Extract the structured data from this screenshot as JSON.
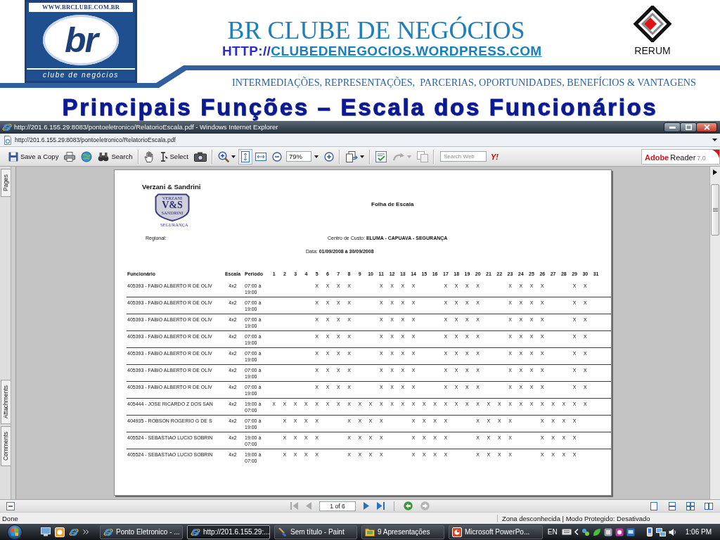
{
  "header": {
    "logo": {
      "web_address": "WWW.BRCLUBE.COM.BR",
      "letters": "br",
      "caption": "clube de negócios"
    },
    "title": "BR CLUBE DE NEGÓCIOS",
    "url_prefix": "HTTP://",
    "url_link": "CLUBEDENEGOCIOS.WORDPRESS.COM",
    "partner_logo": "RERUM",
    "tagline": "INTERMEDIAÇÕES, REPRESENTAÇÕES,  PARCERIAS, OPORTUNIDADES, BENEFÍCIOS & VANTAGENS"
  },
  "slide_title": "Principais Funções – Escala dos Funcionários",
  "window": {
    "title": "http://201.6.155.29:8083/pontoeletronico/RelatorioEscala.pdf - Windows Internet Explorer"
  },
  "address_bar": {
    "value": "http://201.6.155.29:8083/pontoeletronico/RelatorioEscala.pdf"
  },
  "toolbar": {
    "save_label": "Save a Copy",
    "search_label": "Search",
    "select_label": "Select",
    "zoom_value": "79%",
    "arrow_tool_disabled": true,
    "copy_disabled": true,
    "web_search_placeholder": "Search Web",
    "provider_label": "Y!",
    "badge": {
      "brand": "Adobe",
      "product": "Reader",
      "version": "7.0"
    }
  },
  "side_tabs": [
    "Pages",
    "Attachments",
    "Comments"
  ],
  "document": {
    "company": "Verzani & Sandrini",
    "logo": {
      "top": "VERZANI",
      "mark": "V&S",
      "bottom": "SANDRINI",
      "caption": "SEGURANÇA"
    },
    "report_title": "Folha de Escala",
    "regional_label": "Regional:",
    "cost_center": "Centro de Custo: **ELUMA - CAPUAVA - SEGURANÇA**",
    "period": "Data: **01/09/2008 à 30/09/2008**",
    "table": {
      "columns": [
        "Funcionário",
        "Escala",
        "Periodo",
        "1",
        "2",
        "3",
        "4",
        "5",
        "6",
        "7",
        "8",
        "9",
        "10",
        "11",
        "12",
        "13",
        "14",
        "15",
        "16",
        "17",
        "18",
        "19",
        "20",
        "21",
        "22",
        "23",
        "24",
        "25",
        "26",
        "27",
        "28",
        "29",
        "30",
        "31"
      ],
      "rows": [
        {
          "employee": "405393 - FABIO ALBERTO R DE OLIV",
          "scale": "4x2",
          "period": "07:00 à 19:00",
          "days": [
            {
              "kind": "empty"
            },
            {
              "kind": "empty"
            },
            {
              "kind": "empty"
            },
            {
              "kind": "empty"
            },
            {
              "kind": "text",
              "text": "X"
            },
            {
              "kind": "text",
              "text": "X"
            },
            {
              "kind": "text",
              "text": "X"
            },
            {
              "kind": "text",
              "text": "X"
            },
            {
              "kind": "empty"
            },
            {
              "kind": "empty"
            },
            {
              "kind": "text",
              "text": "X"
            },
            {
              "kind": "text",
              "text": "X"
            },
            {
              "kind": "text",
              "text": "X"
            },
            {
              "kind": "text",
              "text": "X"
            },
            {
              "kind": "empty"
            },
            {
              "kind": "empty"
            },
            {
              "kind": "text",
              "text": "X"
            },
            {
              "kind": "text",
              "text": "X"
            },
            {
              "kind": "text",
              "text": "X"
            },
            {
              "kind": "text",
              "text": "X"
            },
            {
              "kind": "empty"
            },
            {
              "kind": "empty"
            },
            {
              "kind": "text",
              "text": "X"
            },
            {
              "kind": "text",
              "text": "X"
            },
            {
              "kind": "text",
              "text": "X"
            },
            {
              "kind": "text",
              "text": "X"
            },
            {
              "kind": "empty"
            },
            {
              "kind": "empty"
            },
            {
              "kind": "text",
              "text": "X"
            },
            {
              "kind": "text",
              "text": "X"
            },
            {
              "kind": "empty"
            }
          ]
        },
        {
          "employee": "405393 - FABIO ALBERTO R DE OLIV",
          "scale": "4x2",
          "period": "07:00 à 19:00",
          "days": [
            {
              "kind": "empty"
            },
            {
              "kind": "empty"
            },
            {
              "kind": "empty"
            },
            {
              "kind": "empty"
            },
            {
              "kind": "text",
              "text": "X"
            },
            {
              "kind": "text",
              "text": "X"
            },
            {
              "kind": "text",
              "text": "X"
            },
            {
              "kind": "text",
              "text": "X"
            },
            {
              "kind": "empty"
            },
            {
              "kind": "empty"
            },
            {
              "kind": "text",
              "text": "X"
            },
            {
              "kind": "text",
              "text": "X"
            },
            {
              "kind": "text",
              "text": "X"
            },
            {
              "kind": "text",
              "text": "X"
            },
            {
              "kind": "empty"
            },
            {
              "kind": "empty"
            },
            {
              "kind": "text",
              "text": "X"
            },
            {
              "kind": "text",
              "text": "X"
            },
            {
              "kind": "text",
              "text": "X"
            },
            {
              "kind": "text",
              "text": "X"
            },
            {
              "kind": "empty"
            },
            {
              "kind": "empty"
            },
            {
              "kind": "text",
              "text": "X"
            },
            {
              "kind": "text",
              "text": "X"
            },
            {
              "kind": "text",
              "text": "X"
            },
            {
              "kind": "text",
              "text": "X"
            },
            {
              "kind": "empty"
            },
            {
              "kind": "empty"
            },
            {
              "kind": "text",
              "text": "X"
            },
            {
              "kind": "text",
              "text": "X"
            },
            {
              "kind": "empty"
            }
          ]
        },
        {
          "employee": "405393 - FABIO ALBERTO R DE OLIV",
          "scale": "4x2",
          "period": "07:00 à 19:00",
          "days": [
            {
              "kind": "empty"
            },
            {
              "kind": "empty"
            },
            {
              "kind": "empty"
            },
            {
              "kind": "empty"
            },
            {
              "kind": "text",
              "text": "X"
            },
            {
              "kind": "text",
              "text": "X"
            },
            {
              "kind": "text",
              "text": "X"
            },
            {
              "kind": "text",
              "text": "X"
            },
            {
              "kind": "empty"
            },
            {
              "kind": "empty"
            },
            {
              "kind": "text",
              "text": "X"
            },
            {
              "kind": "text",
              "text": "X"
            },
            {
              "kind": "text",
              "text": "X"
            },
            {
              "kind": "text",
              "text": "X"
            },
            {
              "kind": "empty"
            },
            {
              "kind": "empty"
            },
            {
              "kind": "text",
              "text": "X"
            },
            {
              "kind": "text",
              "text": "X"
            },
            {
              "kind": "text",
              "text": "X"
            },
            {
              "kind": "text",
              "text": "X"
            },
            {
              "kind": "empty"
            },
            {
              "kind": "empty"
            },
            {
              "kind": "text",
              "text": "X"
            },
            {
              "kind": "text",
              "text": "X"
            },
            {
              "kind": "text",
              "text": "X"
            },
            {
              "kind": "text",
              "text": "X"
            },
            {
              "kind": "empty"
            },
            {
              "kind": "empty"
            },
            {
              "kind": "text",
              "text": "X"
            },
            {
              "kind": "text",
              "text": "X"
            },
            {
              "kind": "empty"
            }
          ]
        },
        {
          "employee": "405393 - FABIO ALBERTO R DE OLIV",
          "scale": "4x2",
          "period": "07:00 à 19:00",
          "days": [
            {
              "kind": "empty"
            },
            {
              "kind": "empty"
            },
            {
              "kind": "empty"
            },
            {
              "kind": "empty"
            },
            {
              "kind": "text",
              "text": "X"
            },
            {
              "kind": "text",
              "text": "X"
            },
            {
              "kind": "text",
              "text": "X"
            },
            {
              "kind": "text",
              "text": "X"
            },
            {
              "kind": "empty"
            },
            {
              "kind": "empty"
            },
            {
              "kind": "text",
              "text": "X"
            },
            {
              "kind": "text",
              "text": "X"
            },
            {
              "kind": "text",
              "text": "X"
            },
            {
              "kind": "text",
              "text": "X"
            },
            {
              "kind": "empty"
            },
            {
              "kind": "empty"
            },
            {
              "kind": "text",
              "text": "X"
            },
            {
              "kind": "text",
              "text": "X"
            },
            {
              "kind": "text",
              "text": "X"
            },
            {
              "kind": "text",
              "text": "X"
            },
            {
              "kind": "empty"
            },
            {
              "kind": "empty"
            },
            {
              "kind": "text",
              "text": "X"
            },
            {
              "kind": "text",
              "text": "X"
            },
            {
              "kind": "text",
              "text": "X"
            },
            {
              "kind": "text",
              "text": "X"
            },
            {
              "kind": "empty"
            },
            {
              "kind": "empty"
            },
            {
              "kind": "text",
              "text": "X"
            },
            {
              "kind": "text",
              "text": "X"
            },
            {
              "kind": "empty"
            }
          ]
        },
        {
          "employee": "405393 - FABIO ALBERTO R DE OLIV",
          "scale": "4x2",
          "period": "07:00 à 19:00",
          "days": [
            {
              "kind": "empty"
            },
            {
              "kind": "empty"
            },
            {
              "kind": "empty"
            },
            {
              "kind": "empty"
            },
            {
              "kind": "text",
              "text": "X"
            },
            {
              "kind": "text",
              "text": "X"
            },
            {
              "kind": "text",
              "text": "X"
            },
            {
              "kind": "text",
              "text": "X"
            },
            {
              "kind": "empty"
            },
            {
              "kind": "empty"
            },
            {
              "kind": "text",
              "text": "X"
            },
            {
              "kind": "text",
              "text": "X"
            },
            {
              "kind": "text",
              "text": "X"
            },
            {
              "kind": "text",
              "text": "X"
            },
            {
              "kind": "empty"
            },
            {
              "kind": "empty"
            },
            {
              "kind": "text",
              "text": "X"
            },
            {
              "kind": "text",
              "text": "X"
            },
            {
              "kind": "text",
              "text": "X"
            },
            {
              "kind": "text",
              "text": "X"
            },
            {
              "kind": "empty"
            },
            {
              "kind": "empty"
            },
            {
              "kind": "text",
              "text": "X"
            },
            {
              "kind": "text",
              "text": "X"
            },
            {
              "kind": "text",
              "text": "X"
            },
            {
              "kind": "text",
              "text": "X"
            },
            {
              "kind": "empty"
            },
            {
              "kind": "empty"
            },
            {
              "kind": "text",
              "text": "X"
            },
            {
              "kind": "text",
              "text": "X"
            },
            {
              "kind": "empty"
            }
          ]
        },
        {
          "employee": "405393 - FABIO ALBERTO R DE OLIV",
          "scale": "4x2",
          "period": "07:00 à 19:00",
          "days": [
            {
              "kind": "empty"
            },
            {
              "kind": "empty"
            },
            {
              "kind": "empty"
            },
            {
              "kind": "empty"
            },
            {
              "kind": "text",
              "text": "X"
            },
            {
              "kind": "text",
              "text": "X"
            },
            {
              "kind": "text",
              "text": "X"
            },
            {
              "kind": "text",
              "text": "X"
            },
            {
              "kind": "empty"
            },
            {
              "kind": "empty"
            },
            {
              "kind": "text",
              "text": "X"
            },
            {
              "kind": "text",
              "text": "X"
            },
            {
              "kind": "text",
              "text": "X"
            },
            {
              "kind": "text",
              "text": "X"
            },
            {
              "kind": "empty"
            },
            {
              "kind": "empty"
            },
            {
              "kind": "text",
              "text": "X"
            },
            {
              "kind": "text",
              "text": "X"
            },
            {
              "kind": "text",
              "text": "X"
            },
            {
              "kind": "text",
              "text": "X"
            },
            {
              "kind": "empty"
            },
            {
              "kind": "empty"
            },
            {
              "kind": "text",
              "text": "X"
            },
            {
              "kind": "text",
              "text": "X"
            },
            {
              "kind": "text",
              "text": "X"
            },
            {
              "kind": "text",
              "text": "X"
            },
            {
              "kind": "empty"
            },
            {
              "kind": "empty"
            },
            {
              "kind": "text",
              "text": "X"
            },
            {
              "kind": "text",
              "text": "X"
            },
            {
              "kind": "empty"
            }
          ]
        },
        {
          "employee": "405393 - FABIO ALBERTO R DE OLIV",
          "scale": "4x2",
          "period": "07:00 à 19:00",
          "days": [
            {
              "kind": "empty"
            },
            {
              "kind": "empty"
            },
            {
              "kind": "empty"
            },
            {
              "kind": "empty"
            },
            {
              "kind": "text",
              "text": "X"
            },
            {
              "kind": "text",
              "text": "X"
            },
            {
              "kind": "text",
              "text": "X"
            },
            {
              "kind": "text",
              "text": "X"
            },
            {
              "kind": "empty"
            },
            {
              "kind": "empty"
            },
            {
              "kind": "text",
              "text": "X"
            },
            {
              "kind": "text",
              "text": "X"
            },
            {
              "kind": "text",
              "text": "X"
            },
            {
              "kind": "text",
              "text": "X"
            },
            {
              "kind": "empty"
            },
            {
              "kind": "empty"
            },
            {
              "kind": "text",
              "text": "X"
            },
            {
              "kind": "text",
              "text": "X"
            },
            {
              "kind": "text",
              "text": "X"
            },
            {
              "kind": "text",
              "text": "X"
            },
            {
              "kind": "empty"
            },
            {
              "kind": "empty"
            },
            {
              "kind": "text",
              "text": "X"
            },
            {
              "kind": "text",
              "text": "X"
            },
            {
              "kind": "text",
              "text": "X"
            },
            {
              "kind": "text",
              "text": "X"
            },
            {
              "kind": "empty"
            },
            {
              "kind": "empty"
            },
            {
              "kind": "text",
              "text": "X"
            },
            {
              "kind": "text",
              "text": "X"
            },
            {
              "kind": "empty"
            }
          ]
        },
        {
          "employee": "405444 - JOSE RICARDO Z DOS SAN",
          "scale": "4x2",
          "period": "19:00 à 07:00",
          "days": [
            {
              "kind": "text",
              "text": "X"
            },
            {
              "kind": "text",
              "text": "X"
            },
            {
              "kind": "text",
              "text": "X"
            },
            {
              "kind": "text",
              "text": "X"
            },
            {
              "kind": "text",
              "text": "X"
            },
            {
              "kind": "text",
              "text": "X"
            },
            {
              "kind": "text",
              "text": "X"
            },
            {
              "kind": "text",
              "text": "X"
            },
            {
              "kind": "text",
              "text": "X"
            },
            {
              "kind": "text",
              "text": "X"
            },
            {
              "kind": "text",
              "text": "X"
            },
            {
              "kind": "text",
              "text": "X"
            },
            {
              "kind": "text",
              "text": "X"
            },
            {
              "kind": "text",
              "text": "X"
            },
            {
              "kind": "text",
              "text": "X"
            },
            {
              "kind": "text",
              "text": "X"
            },
            {
              "kind": "text",
              "text": "X"
            },
            {
              "kind": "text",
              "text": "X"
            },
            {
              "kind": "text",
              "text": "X"
            },
            {
              "kind": "text",
              "text": "X"
            },
            {
              "kind": "text",
              "text": "X"
            },
            {
              "kind": "text",
              "text": "X"
            },
            {
              "kind": "text",
              "text": "X"
            },
            {
              "kind": "text",
              "text": "X"
            },
            {
              "kind": "text",
              "text": "X"
            },
            {
              "kind": "text",
              "text": "X"
            },
            {
              "kind": "text",
              "text": "X"
            },
            {
              "kind": "text",
              "text": "X"
            },
            {
              "kind": "text",
              "text": "X"
            },
            {
              "kind": "text",
              "text": "X"
            },
            {
              "kind": "empty"
            }
          ]
        },
        {
          "employee": "404935 - ROBSON ROGERIO G DE S",
          "scale": "4x2",
          "period": "07:00 à 19:00",
          "days": [
            {
              "kind": "empty"
            },
            {
              "kind": "text",
              "text": "X"
            },
            {
              "kind": "text",
              "text": "X"
            },
            {
              "kind": "text",
              "text": "X"
            },
            {
              "kind": "text",
              "text": "X"
            },
            {
              "kind": "empty"
            },
            {
              "kind": "empty"
            },
            {
              "kind": "text",
              "text": "X"
            },
            {
              "kind": "text",
              "text": "X"
            },
            {
              "kind": "text",
              "text": "X"
            },
            {
              "kind": "text",
              "text": "X"
            },
            {
              "kind": "empty"
            },
            {
              "kind": "empty"
            },
            {
              "kind": "text",
              "text": "X"
            },
            {
              "kind": "text",
              "text": "X"
            },
            {
              "kind": "text",
              "text": "X"
            },
            {
              "kind": "text",
              "text": "X"
            },
            {
              "kind": "empty"
            },
            {
              "kind": "empty"
            },
            {
              "kind": "text",
              "text": "X"
            },
            {
              "kind": "text",
              "text": "X"
            },
            {
              "kind": "text",
              "text": "X"
            },
            {
              "kind": "text",
              "text": "X"
            },
            {
              "kind": "empty"
            },
            {
              "kind": "empty"
            },
            {
              "kind": "text",
              "text": "X"
            },
            {
              "kind": "text",
              "text": "X"
            },
            {
              "kind": "text",
              "text": "X"
            },
            {
              "kind": "text",
              "text": "X"
            },
            {
              "kind": "empty"
            },
            {
              "kind": "empty"
            }
          ]
        },
        {
          "employee": "405524 - SEBASTIAO LUCIO SOBRIN",
          "scale": "4x2",
          "period": "19:00 à 07:00",
          "days": [
            {
              "kind": "empty"
            },
            {
              "kind": "text",
              "text": "X"
            },
            {
              "kind": "text",
              "text": "X"
            },
            {
              "kind": "text",
              "text": "X"
            },
            {
              "kind": "text",
              "text": "X"
            },
            {
              "kind": "empty"
            },
            {
              "kind": "empty"
            },
            {
              "kind": "text",
              "text": "X"
            },
            {
              "kind": "text",
              "text": "X"
            },
            {
              "kind": "text",
              "text": "X"
            },
            {
              "kind": "text",
              "text": "X"
            },
            {
              "kind": "empty"
            },
            {
              "kind": "empty"
            },
            {
              "kind": "text",
              "text": "X"
            },
            {
              "kind": "text",
              "text": "X"
            },
            {
              "kind": "text",
              "text": "X"
            },
            {
              "kind": "text",
              "text": "X"
            },
            {
              "kind": "empty"
            },
            {
              "kind": "empty"
            },
            {
              "kind": "text",
              "text": "X"
            },
            {
              "kind": "text",
              "text": "X"
            },
            {
              "kind": "text",
              "text": "X"
            },
            {
              "kind": "text",
              "text": "X"
            },
            {
              "kind": "empty"
            },
            {
              "kind": "empty"
            },
            {
              "kind": "text",
              "text": "X"
            },
            {
              "kind": "text",
              "text": "X"
            },
            {
              "kind": "text",
              "text": "X"
            },
            {
              "kind": "text",
              "text": "X"
            },
            {
              "kind": "empty"
            },
            {
              "kind": "empty"
            }
          ]
        },
        {
          "employee": "405524 - SEBASTIAO LUCIO SOBRIN",
          "scale": "4x2",
          "period": "19:00 à 07:00",
          "days": [
            {
              "kind": "empty"
            },
            {
              "kind": "text",
              "text": "X"
            },
            {
              "kind": "text",
              "text": "X"
            },
            {
              "kind": "text",
              "text": "X"
            },
            {
              "kind": "text",
              "text": "X"
            },
            {
              "kind": "empty"
            },
            {
              "kind": "empty"
            },
            {
              "kind": "text",
              "text": "X"
            },
            {
              "kind": "text",
              "text": "X"
            },
            {
              "kind": "text",
              "text": "X"
            },
            {
              "kind": "text",
              "text": "X"
            },
            {
              "kind": "empty"
            },
            {
              "kind": "empty"
            },
            {
              "kind": "text",
              "text": "X"
            },
            {
              "kind": "text",
              "text": "X"
            },
            {
              "kind": "text",
              "text": "X"
            },
            {
              "kind": "text",
              "text": "X"
            },
            {
              "kind": "empty"
            },
            {
              "kind": "empty"
            },
            {
              "kind": "text",
              "text": "X"
            },
            {
              "kind": "text",
              "text": "X"
            },
            {
              "kind": "text",
              "text": "X"
            },
            {
              "kind": "text",
              "text": "X"
            },
            {
              "kind": "empty"
            },
            {
              "kind": "empty"
            },
            {
              "kind": "text",
              "text": "X"
            },
            {
              "kind": "text",
              "text": "X"
            },
            {
              "kind": "text",
              "text": "X"
            },
            {
              "kind": "text",
              "text": "X"
            },
            {
              "kind": "empty"
            },
            {
              "kind": "empty"
            }
          ]
        }
      ]
    }
  },
  "page_nav": {
    "first_disabled": true,
    "previous_disabled": true,
    "page": "1 of 6",
    "next_disabled": false,
    "last_disabled": false,
    "back_disabled": false,
    "forward_disabled": true
  },
  "status_bar": {
    "left": "Done",
    "right": "Zona desconhecida | Modo Protegido: Desativado"
  },
  "taskbar": {
    "tasks": [
      {
        "kind": "browser",
        "label": "Ponto Eletronico - ...",
        "selected": false
      },
      {
        "kind": "browser",
        "label": "http://201.6.155.29:...",
        "selected": true
      },
      {
        "kind": "paint",
        "label": "Sem título - Paint",
        "selected": false
      },
      {
        "kind": "folder",
        "label": "9 Apresentações",
        "selected": false
      },
      {
        "kind": "presentation",
        "label": "Microsoft PowerPo...",
        "selected": false
      }
    ],
    "language": "EN",
    "clock": "1:06 PM"
  }
}
